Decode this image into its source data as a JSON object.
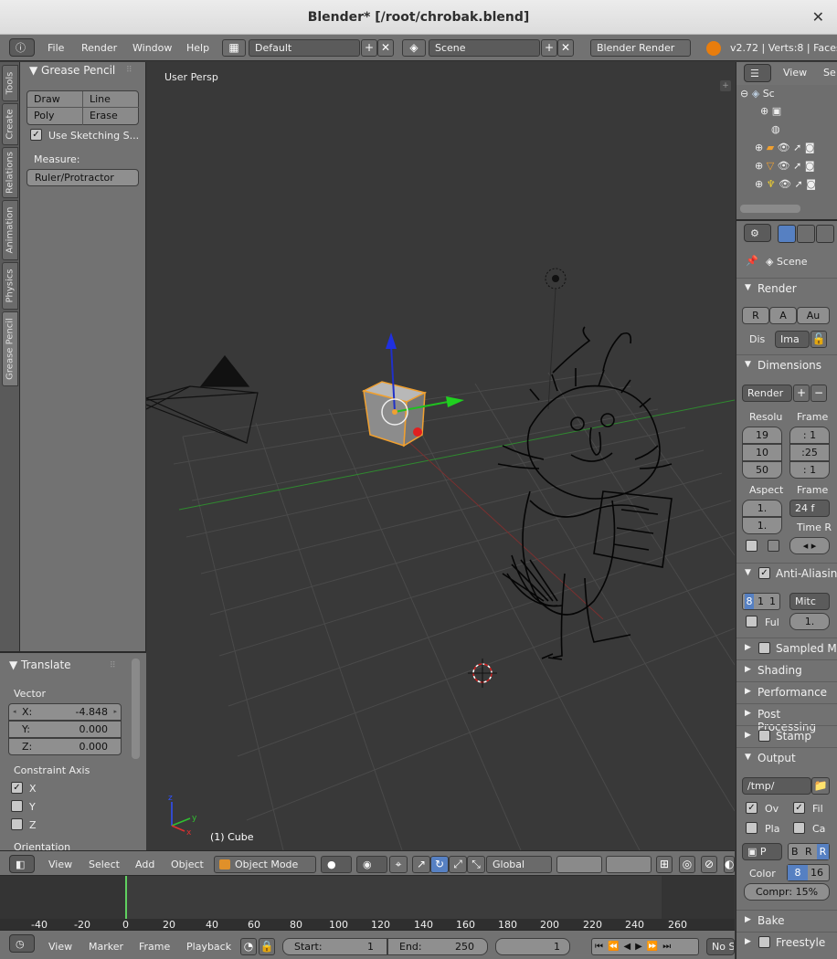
{
  "window": {
    "title": "Blender* [/root/chrobak.blend]"
  },
  "info_header": {
    "menus": [
      "File",
      "Render",
      "Window",
      "Help"
    ],
    "layout_field": "Default",
    "scene_field": "Scene",
    "engine": "Blender Render",
    "stats": "v2.72 | Verts:8 | Faces"
  },
  "tool_tabs": [
    "Tools",
    "Create",
    "Relations",
    "Animation",
    "Physics",
    "Grease Pencil"
  ],
  "grease_pencil": {
    "title": "Grease Pencil",
    "buttons": [
      "Draw",
      "Line",
      "Poly",
      "Erase"
    ],
    "sketching": "Use Sketching S...",
    "measure_label": "Measure:",
    "ruler": "Ruler/Protractor"
  },
  "translate_panel": {
    "title": "Translate",
    "vector_label": "Vector",
    "x_label": "X:",
    "x_value": "-4.848",
    "y_label": "Y:",
    "y_value": "0.000",
    "z_label": "Z:",
    "z_value": "0.000",
    "constraint_label": "Constraint Axis",
    "axes": [
      "X",
      "Y",
      "Z"
    ],
    "orientation_label": "Orientation"
  },
  "viewport": {
    "view_name": "User Persp",
    "object_label": "(1) Cube"
  },
  "viewport_header": {
    "menus": [
      "View",
      "Select",
      "Add",
      "Object"
    ],
    "mode": "Object Mode",
    "orientation": "Global"
  },
  "timeline": {
    "ticks": [
      "-40",
      "-20",
      "0",
      "20",
      "40",
      "60",
      "80",
      "100",
      "120",
      "140",
      "160",
      "180",
      "200",
      "220",
      "240",
      "260"
    ],
    "menus": [
      "View",
      "Marker",
      "Frame",
      "Playback"
    ],
    "start_label": "Start:",
    "start_value": "1",
    "end_label": "End:",
    "end_value": "250",
    "current_frame": "1",
    "sync": "No S"
  },
  "outliner": {
    "header_view": "View",
    "header_search": "Se",
    "root": "Sc"
  },
  "properties": {
    "context": "Scene",
    "render_panel": "Render",
    "render_buttons": [
      "R",
      "A",
      "Au"
    ],
    "display_label": "Dis",
    "display_value": "Ima",
    "dimensions_panel": "Dimensions",
    "preset": "Render",
    "resolution_label": "Resolu",
    "frame_label": "Frame",
    "res_x": "19",
    "res_y": "10",
    "res_pct": "50",
    "frame_start": ": 1",
    "frame_end": ":25",
    "frame_step": ": 1",
    "aspect_label": "Aspect",
    "frame_rate_label": "Frame",
    "aspect_x": "1.",
    "aspect_y": "1.",
    "fps": "24 f",
    "time_remap": "Time R",
    "aa_panel": "Anti-Aliasin",
    "aa_samples": [
      "8",
      "1",
      "1"
    ],
    "aa_filter": "Mitc",
    "full_sample": "Ful",
    "filter_size": "1.",
    "sampled_panel": "Sampled M",
    "shading_panel": "Shading",
    "performance_panel": "Performance",
    "postproc_panel": "Post Processing",
    "stamp_panel": "Stamp",
    "output_panel": "Output",
    "output_path": "/tmp/",
    "overwrite": "Ov",
    "file_ext": "Fil",
    "placeholders": "Pla",
    "cache": "Ca",
    "format": "P",
    "color_modes": [
      "B",
      "R",
      "R"
    ],
    "color_label": "Color",
    "color_depth": [
      "8",
      "16"
    ],
    "compression": "Compr: 15%",
    "bake_panel": "Bake",
    "freestyle_panel": "Freestyle"
  },
  "colors": {
    "accent_blue": "#5680c2",
    "selection_orange": "#f0a030",
    "panel_gray": "#727272",
    "viewport_gray": "#393939"
  }
}
